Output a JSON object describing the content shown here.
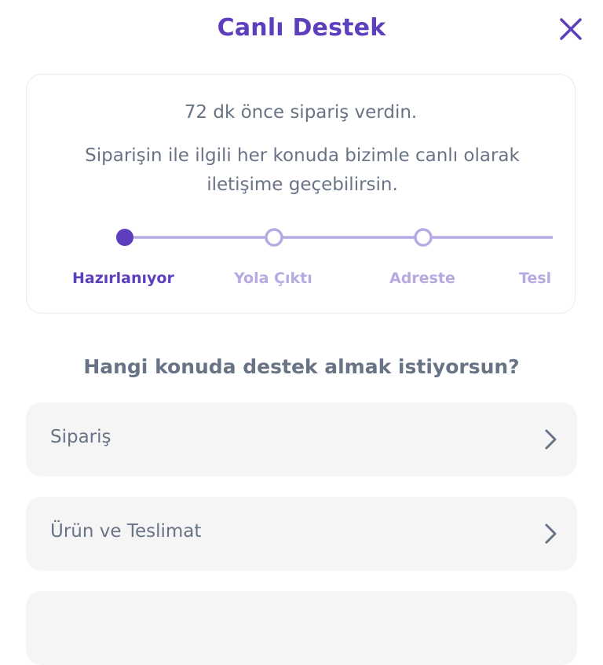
{
  "header": {
    "title": "Canlı Destek",
    "close_icon": "close-icon"
  },
  "status_card": {
    "order_time": "72 dk önce sipariş verdin.",
    "support_text": "Siparişin ile ilgili her konuda bizimle canlı olarak iletişime geçebilirsin.",
    "steps": [
      {
        "label": "Hazırlanıyor",
        "active": true
      },
      {
        "label": "Yola Çıktı",
        "active": false
      },
      {
        "label": "Adreste",
        "active": false
      },
      {
        "label": "Tesl",
        "active": false
      }
    ]
  },
  "section": {
    "title": "Hangi konuda destek almak istiyorsun?"
  },
  "topics": [
    {
      "label": "Sipariş",
      "icon": "chevron-right-icon"
    },
    {
      "label": "Ürün ve Teslimat",
      "icon": "chevron-right-icon"
    },
    {
      "label": "",
      "icon": ""
    }
  ],
  "colors": {
    "brand": "#5d3ebc",
    "brand_light": "#b7a9e2",
    "text_gray": "#697386",
    "item_bg": "#f5f5f5"
  }
}
